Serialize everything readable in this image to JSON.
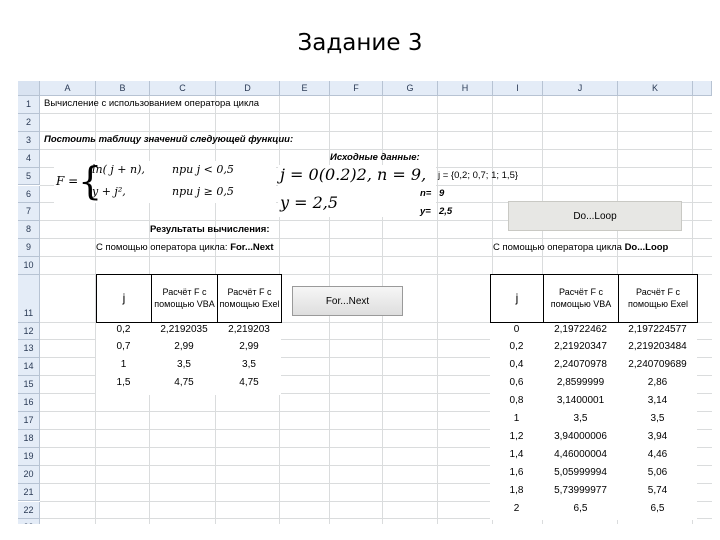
{
  "slide_title": "Задание 3",
  "columns": [
    "A",
    "B",
    "C",
    "D",
    "E",
    "F",
    "G",
    "H",
    "I",
    "J",
    "K"
  ],
  "rows": [
    "1",
    "2",
    "3",
    "4",
    "5",
    "6",
    "7",
    "8",
    "9",
    "10",
    "11",
    "12",
    "13",
    "14",
    "15",
    "16",
    "17",
    "18",
    "19",
    "20",
    "21",
    "22",
    "23"
  ],
  "cells": {
    "a1": "Вычисление с использованием оператора цикла",
    "a3": "Постоить таблицу значений следующей функции:",
    "e4": "Исходные данные:",
    "formula_f": "F =",
    "formula_case1_expr": "ln( j + n),",
    "formula_case1_cond": "при  j < 0,5",
    "formula_case2_expr": "y + j²,",
    "formula_case2_cond": "при  j ≥ 0,5",
    "formula_j": "j = 0(0.2)2, n = 9,",
    "formula_y": "y = 2,5",
    "j_set": "j = {0,2; 0,7; 1; 1,5}",
    "n_label": "n=",
    "n_value": "9",
    "y_label": "y=",
    "y_value": "2,5",
    "b8": "Результаты вычисления:",
    "a9_prefix": "С помощью оператора цикла: ",
    "a9_bold": "For...Next",
    "h9_prefix": "С помощью оператора цикла ",
    "h9_bold": "Do...Loop"
  },
  "buttons": {
    "do_loop": "Do...Loop",
    "for_next": "For...Next"
  },
  "table_left": {
    "headers": [
      "j",
      "Расчёт F с помощью VBA",
      "Расчёт F с помощью Exel"
    ],
    "rows": [
      [
        "0,2",
        "2,2192035",
        "2,219203"
      ],
      [
        "0,7",
        "2,99",
        "2,99"
      ],
      [
        "1",
        "3,5",
        "3,5"
      ],
      [
        "1,5",
        "4,75",
        "4,75"
      ]
    ]
  },
  "table_right": {
    "headers": [
      "j",
      "Расчёт F с помощью VBA",
      "Расчёт F с помощью Exel"
    ],
    "rows": [
      [
        "0",
        "2,19722462",
        "2,197224577"
      ],
      [
        "0,2",
        "2,21920347",
        "2,219203484"
      ],
      [
        "0,4",
        "2,24070978",
        "2,240709689"
      ],
      [
        "0,6",
        "2,8599999",
        "2,86"
      ],
      [
        "0,8",
        "3,1400001",
        "3,14"
      ],
      [
        "1",
        "3,5",
        "3,5"
      ],
      [
        "1,2",
        "3,94000006",
        "3,94"
      ],
      [
        "1,4",
        "4,46000004",
        "4,46"
      ],
      [
        "1,6",
        "5,05999994",
        "5,06"
      ],
      [
        "1,8",
        "5,73999977",
        "5,74"
      ],
      [
        "2",
        "6,5",
        "6,5"
      ]
    ]
  }
}
